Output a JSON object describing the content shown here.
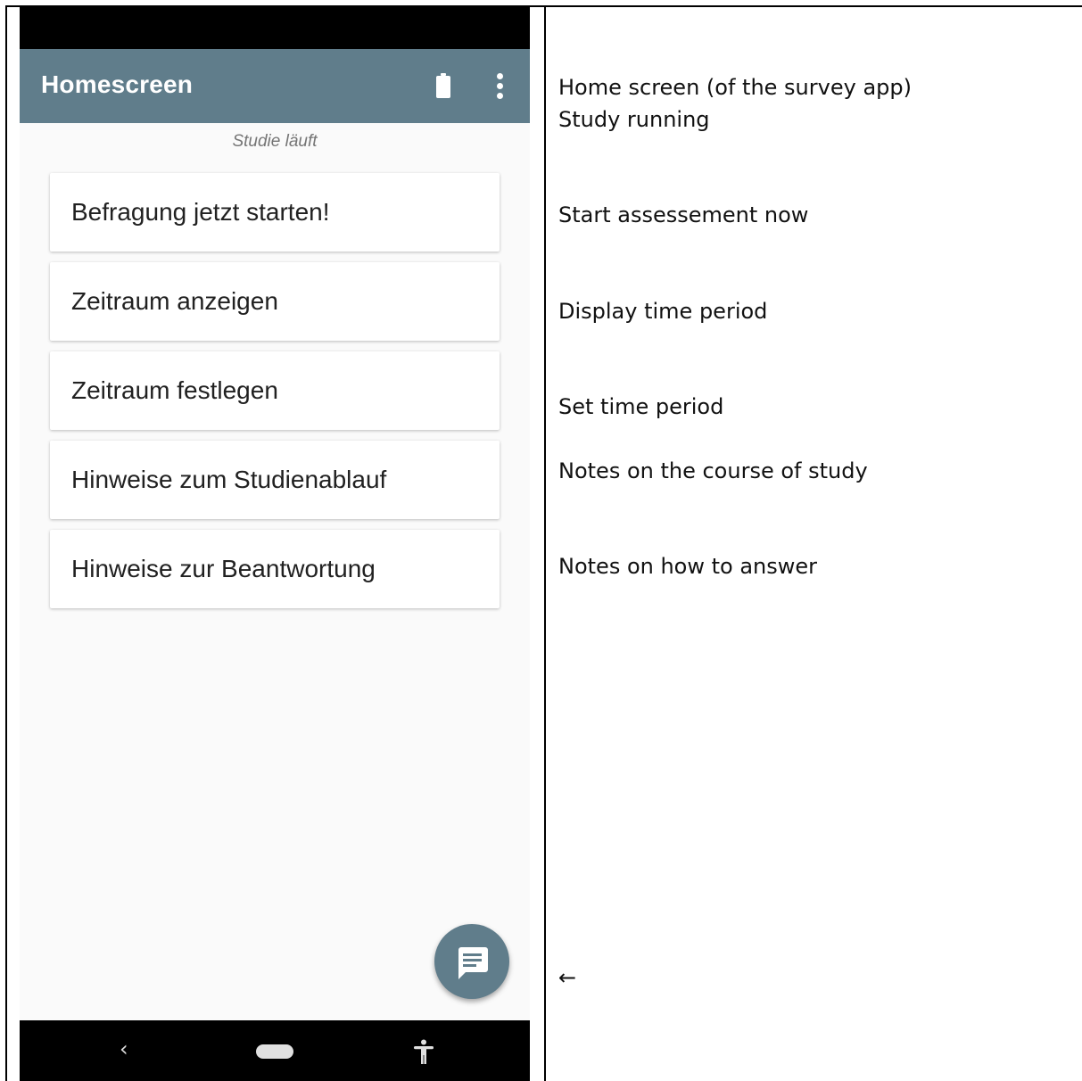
{
  "app": {
    "title": "Homescreen",
    "status": "Studie läuft",
    "icons": {
      "battery": "battery-icon",
      "overflow": "more-vert-icon",
      "fab": "message-icon",
      "back": "back-chevron-icon",
      "home": "home-pill-icon",
      "accessibility": "accessibility-icon"
    },
    "menu_items": [
      {
        "label": "Befragung jetzt starten!"
      },
      {
        "label": "Zeitraum anzeigen"
      },
      {
        "label": "Zeitraum festlegen"
      },
      {
        "label": "Hinweise zum Studienablauf"
      },
      {
        "label": "Hinweise zur Beantwortung"
      }
    ],
    "nav": {
      "back_glyph": "‹"
    },
    "colors": {
      "app_bar": "#607d8b",
      "background": "#fafafa",
      "fab": "#607d8b"
    }
  },
  "translations": {
    "home_screen": "Home screen (of the survey app)",
    "study_running": "Study running",
    "start_assessment": "Start assessement now",
    "display_period": "Display time period",
    "set_period": "Set time period",
    "notes_course": "Notes on the course of study",
    "notes_answer": "Notes on how to answer",
    "arrow": "←"
  }
}
